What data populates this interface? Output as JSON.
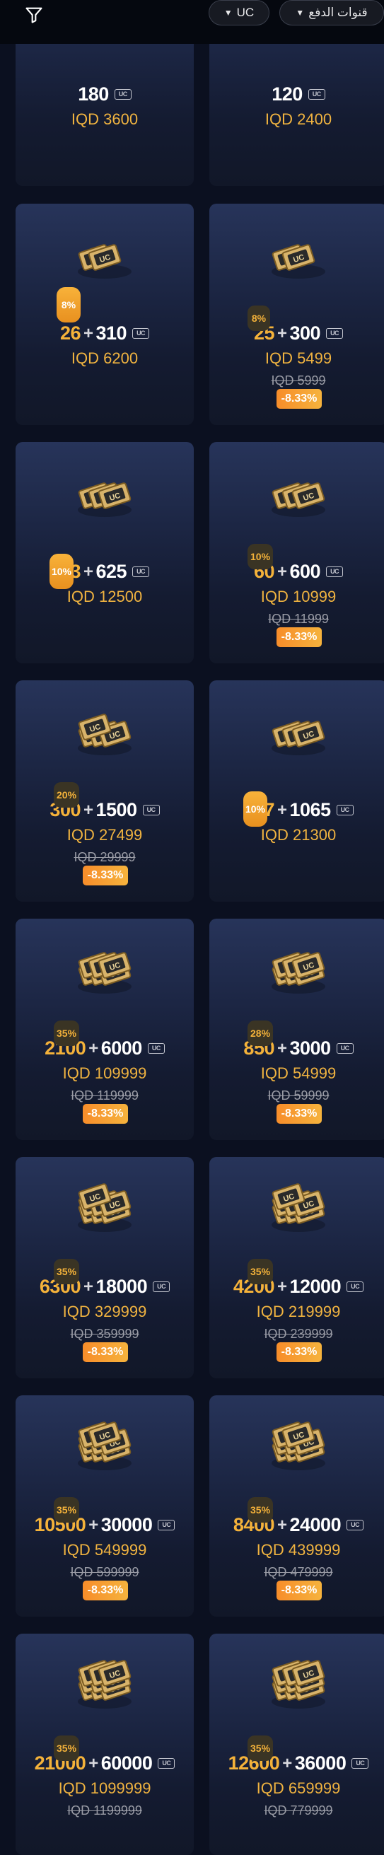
{
  "header": {
    "uc_filter_label": "UC",
    "payment_filter_label": "قنوات الدفع"
  },
  "packages": [
    {
      "base": "180",
      "bonus": "",
      "price": "IQD 3600",
      "old_price": "",
      "discount": "",
      "bonus_pct": ""
    },
    {
      "base": "120",
      "bonus": "",
      "price": "IQD 2400",
      "old_price": "",
      "discount": "",
      "bonus_pct": ""
    },
    {
      "base": "310",
      "bonus": "26",
      "price": "IQD 6200",
      "old_price": "",
      "discount": "",
      "bonus_pct": "8%"
    },
    {
      "base": "300",
      "bonus": "25",
      "price": "IQD 5499",
      "old_price": "IQD 5999",
      "discount": "-8.33%",
      "bonus_pct": "8%"
    },
    {
      "base": "625",
      "bonus": "63",
      "price": "IQD 12500",
      "old_price": "",
      "discount": "",
      "bonus_pct": "10%"
    },
    {
      "base": "600",
      "bonus": "60",
      "price": "IQD 10999",
      "old_price": "IQD 11999",
      "discount": "-8.33%",
      "bonus_pct": "10%"
    },
    {
      "base": "1500",
      "bonus": "300",
      "price": "IQD 27499",
      "old_price": "IQD 29999",
      "discount": "-8.33%",
      "bonus_pct": "20%"
    },
    {
      "base": "1065",
      "bonus": "107",
      "price": "IQD 21300",
      "old_price": "",
      "discount": "",
      "bonus_pct": "10%"
    },
    {
      "base": "6000",
      "bonus": "2100",
      "price": "IQD 109999",
      "old_price": "IQD 119999",
      "discount": "-8.33%",
      "bonus_pct": "35%"
    },
    {
      "base": "3000",
      "bonus": "850",
      "price": "IQD 54999",
      "old_price": "IQD 59999",
      "discount": "-8.33%",
      "bonus_pct": "28%"
    },
    {
      "base": "18000",
      "bonus": "6300",
      "price": "IQD 329999",
      "old_price": "IQD 359999",
      "discount": "-8.33%",
      "bonus_pct": "35%"
    },
    {
      "base": "12000",
      "bonus": "4200",
      "price": "IQD 219999",
      "old_price": "IQD 239999",
      "discount": "-8.33%",
      "bonus_pct": "35%"
    },
    {
      "base": "30000",
      "bonus": "10500",
      "price": "IQD 549999",
      "old_price": "IQD 599999",
      "discount": "-8.33%",
      "bonus_pct": "35%"
    },
    {
      "base": "24000",
      "bonus": "8400",
      "price": "IQD 439999",
      "old_price": "IQD 479999",
      "discount": "-8.33%",
      "bonus_pct": "35%"
    },
    {
      "base": "60000",
      "bonus": "21000",
      "price": "IQD 1099999",
      "old_price": "IQD 1199999",
      "discount": "",
      "bonus_pct": "35%"
    },
    {
      "base": "36000",
      "bonus": "12600",
      "price": "IQD 659999",
      "old_price": "IQD 779999",
      "discount": "",
      "bonus_pct": "35%"
    }
  ],
  "icons": {
    "filter": "filter-icon",
    "uc_chip": "uc-currency-icon",
    "pack": "uc-pack-icon"
  },
  "colors": {
    "accent": "#f4b23a",
    "discount": "#f78d2a",
    "card_top": "#27345a",
    "background": "#0b1020"
  }
}
